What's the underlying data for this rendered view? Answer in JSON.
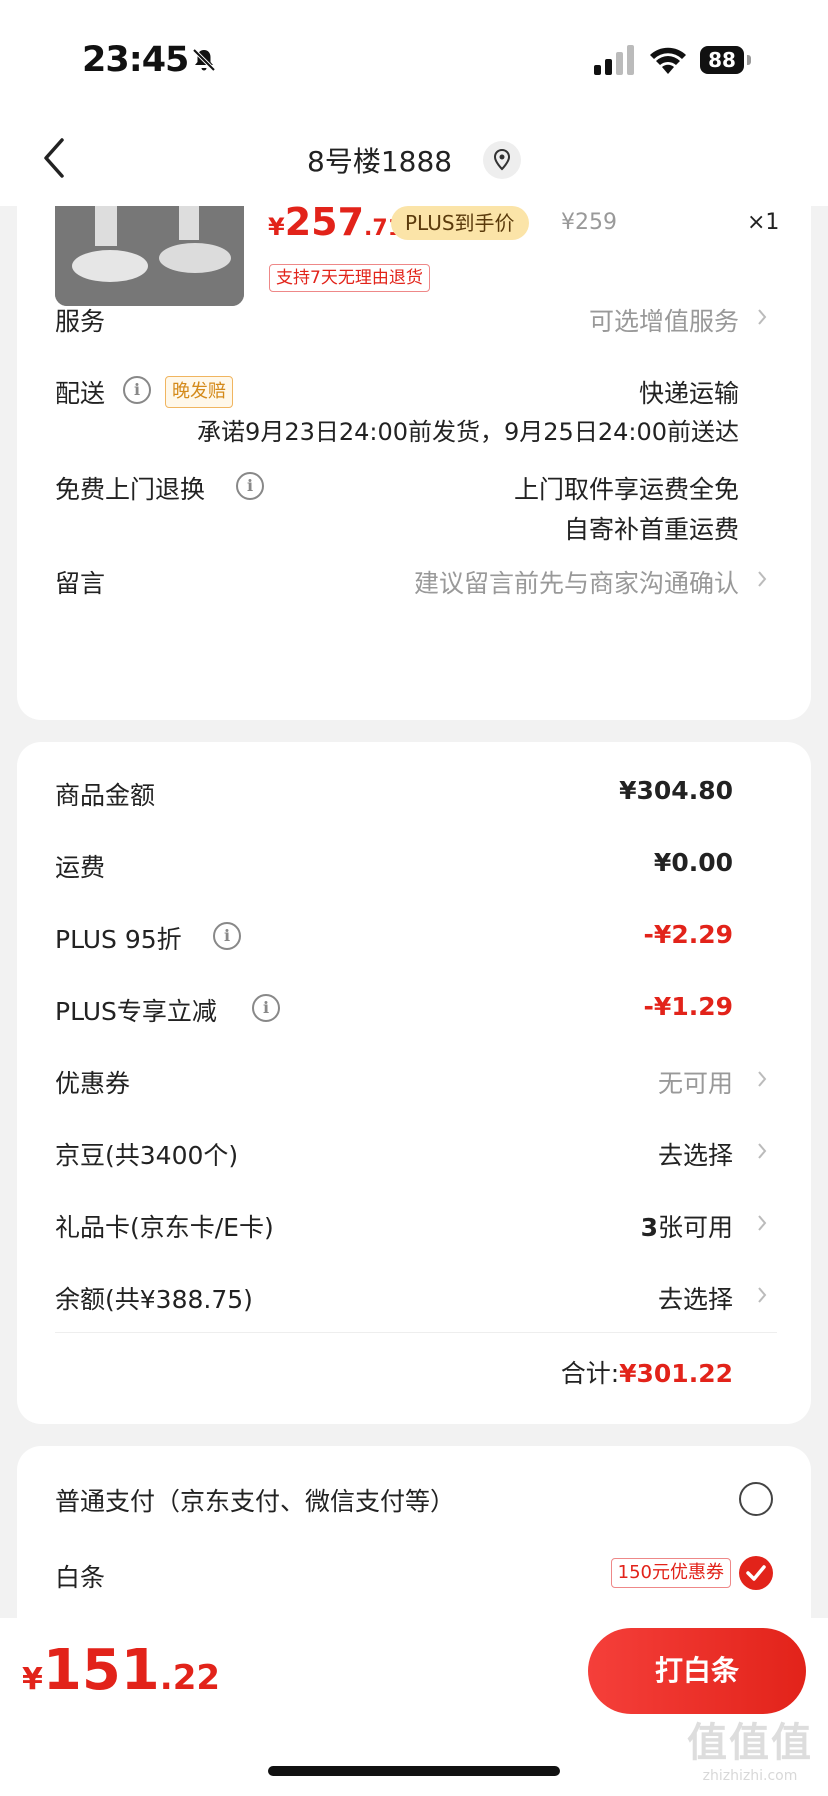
{
  "status_bar": {
    "time": "23:45",
    "battery": "88"
  },
  "nav": {
    "title": "8号楼1888"
  },
  "product": {
    "currency": "¥",
    "price_int": "257",
    "price_dec": ".71",
    "plus_tag": "PLUS到手价",
    "original_price": "¥259",
    "quantity": "×1",
    "return_tag": "支持7天无理由退货"
  },
  "order": {
    "service": {
      "label": "服务",
      "value": "可选增值服务"
    },
    "delivery": {
      "label": "配送",
      "late_tag": "晚发赔",
      "value": "快递运输",
      "promise": "承诺9月23日24:00前发货，9月25日24:00前送达"
    },
    "return": {
      "label": "免费上门退换",
      "line1": "上门取件享运费全免",
      "line2": "自寄补首重运费"
    },
    "note": {
      "label": "留言",
      "placeholder": "建议留言前先与商家沟通确认"
    }
  },
  "summary": {
    "rows": [
      {
        "label": "商品金额",
        "value": "¥304.80"
      },
      {
        "label": "运费",
        "value": "¥0.00"
      },
      {
        "label": "PLUS 95折",
        "value": "-¥2.29"
      },
      {
        "label": "PLUS专享立减",
        "value": "-¥1.29"
      },
      {
        "label": "优惠券",
        "value": "无可用"
      },
      {
        "label": "京豆(共3400个)",
        "value": "去选择"
      },
      {
        "label": "礼品卡(京东卡/E卡)",
        "value_num": "3",
        "value": "张可用"
      },
      {
        "label": "余额(共¥388.75)",
        "value": "去选择"
      }
    ],
    "total_label": "合计:",
    "total_value": "¥301.22"
  },
  "payment": {
    "normal_label": "普通支付（京东支付、微信支付等）",
    "baitiao_label": "白条",
    "coupon_tag": "150元优惠券"
  },
  "bottom": {
    "currency": "¥",
    "total_int": "151",
    "total_dec": ".22",
    "button_label": "打白条"
  },
  "watermark": {
    "main": "值值值",
    "sub": "zhizhizhi.com"
  },
  "colors": {
    "accent_red": "#e2231a",
    "plus_gold": "#fbe4a8",
    "background": "#f2f2f2"
  }
}
